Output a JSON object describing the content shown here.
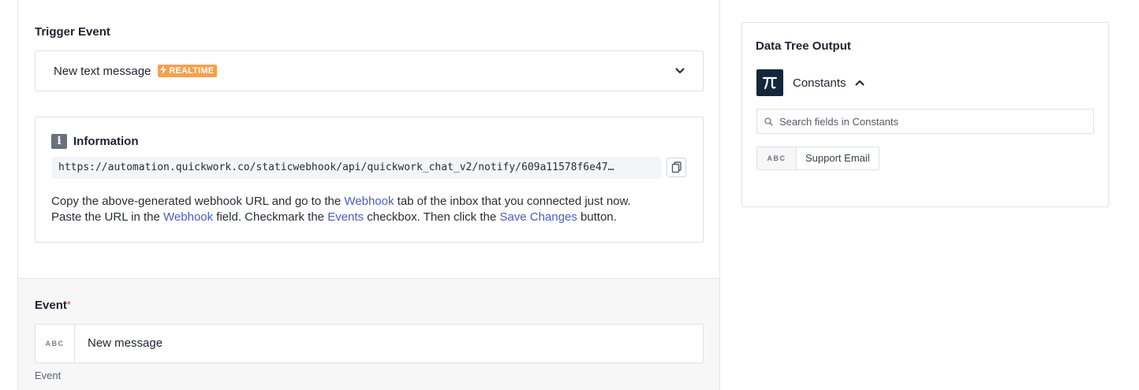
{
  "trigger": {
    "label": "Trigger Event",
    "selected": "New text message",
    "badge": "REALTIME"
  },
  "information": {
    "title": "Information",
    "webhook_url": "https://automation.quickwork.co/staticwebhook/api/quickwork_chat_v2/notify/609a11578f6e47…",
    "text": {
      "p1": "Copy the above-generated webhook URL and go to the ",
      "link1": "Webhook",
      "p2": " tab of the inbox that you connected just now.",
      "p3": "Paste the URL in the ",
      "link2": "Webhook",
      "p4": " field. Checkmark the ",
      "link3": "Events",
      "p5": " checkbox. Then click the ",
      "link4": "Save Changes",
      "p6": " button."
    }
  },
  "event_field": {
    "label": "Event",
    "required_marker": "*",
    "type_tag": "ABC",
    "value": "New message",
    "hint": "Event"
  },
  "data_tree": {
    "title": "Data Tree Output",
    "group_label": "Constants",
    "search_placeholder": "Search fields in Constants",
    "fields": [
      {
        "type": "ABC",
        "label": "Support Email"
      }
    ]
  },
  "icons": {
    "dropdown": "chevron-down-icon",
    "info": "info-icon",
    "copy": "copy-icon",
    "constants": "pi-icon",
    "collapse": "chevron-up-icon",
    "search": "search-icon",
    "realtime": "lightning-icon"
  },
  "colors": {
    "badge": "#f6a04d",
    "link": "#4a5cc7",
    "required": "#d33d3d",
    "constants_logo": "#15263b"
  }
}
